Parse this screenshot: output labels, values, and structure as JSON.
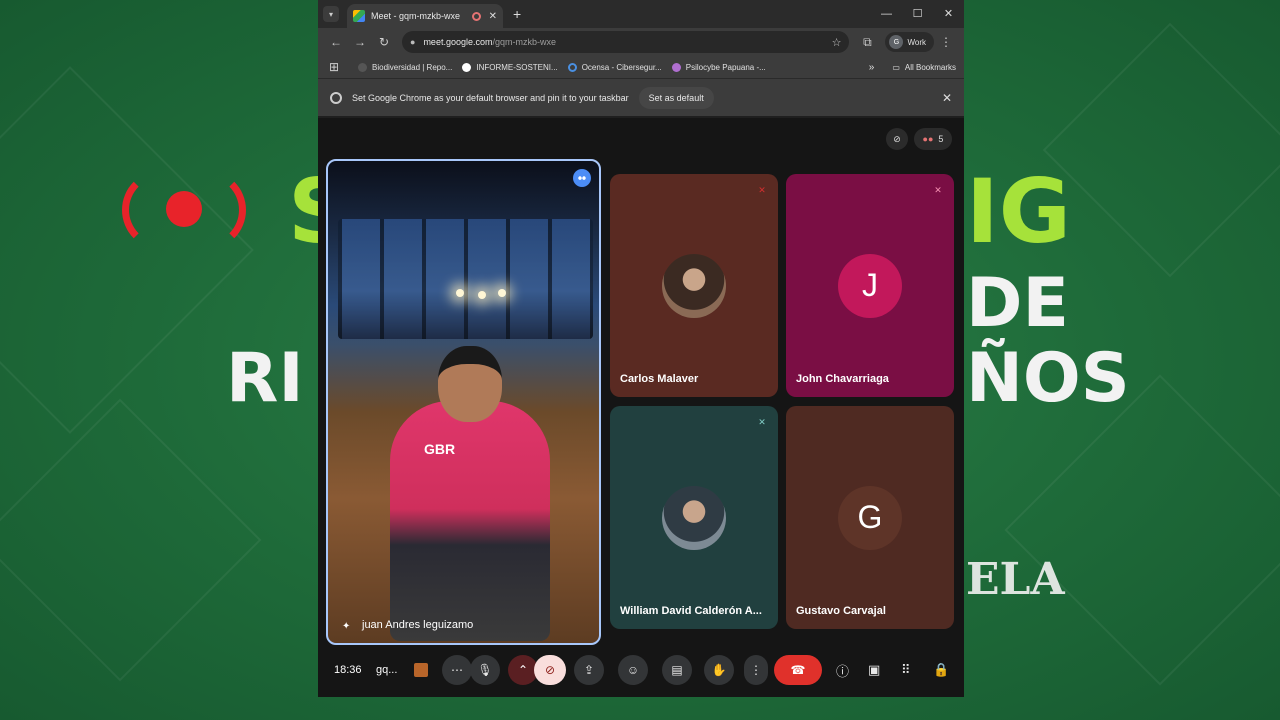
{
  "background": {
    "headline_top": "S",
    "headline_top_right": "IG",
    "line2_right": "DE",
    "line3_left": "RI",
    "line3_right": "ÑOS",
    "signature": "ELA",
    "live_icon": "broadcast-icon"
  },
  "browser": {
    "tab_title": "Meet - gqm-mzkb-wxe",
    "url_host": "meet.google.com",
    "url_path": "/gqm-mzkb-wxe",
    "profile_label": "Work",
    "profile_initial": "G",
    "bookmarks": [
      {
        "label": "Biodiversidad | Repo...",
        "color": "#3c3c3c"
      },
      {
        "label": "INFORME-SOSTENI...",
        "color": "#ffffff"
      },
      {
        "label": "Ocensa - Cibersegur...",
        "color": "#1a73e8"
      },
      {
        "label": "Psilocybe Papuana -...",
        "color": "#8e24aa"
      }
    ],
    "all_bookmarks": "All Bookmarks",
    "infobar_text": "Set Google Chrome as your default browser and pin it to your taskbar",
    "infobar_button": "Set as default"
  },
  "meet": {
    "participant_count": "5",
    "main": {
      "name": "juan Andres leguizamo",
      "logo_text": "GBR"
    },
    "tiles": [
      {
        "name": "Carlos Malaver",
        "color": "#5a2a22",
        "type": "photo",
        "muted": true
      },
      {
        "name": "John Chavarriaga",
        "color": "#7a0e44",
        "type": "letter",
        "letter": "J",
        "letter_bg": "#c2185b",
        "muted": true
      },
      {
        "name": "William David Calderón A...",
        "color": "#21403f",
        "type": "photo",
        "muted": false
      },
      {
        "name": "Gustavo Carvajal",
        "color": "#4f2a22",
        "type": "letter",
        "letter": "G",
        "letter_bg": "#5e3428",
        "muted": false
      }
    ],
    "time": "18:36",
    "meeting_code": "gq..."
  },
  "colors": {
    "accent_blue": "#a8c7fa",
    "end_call_red": "#e0312b",
    "bg_green": "#1f6b3a"
  }
}
